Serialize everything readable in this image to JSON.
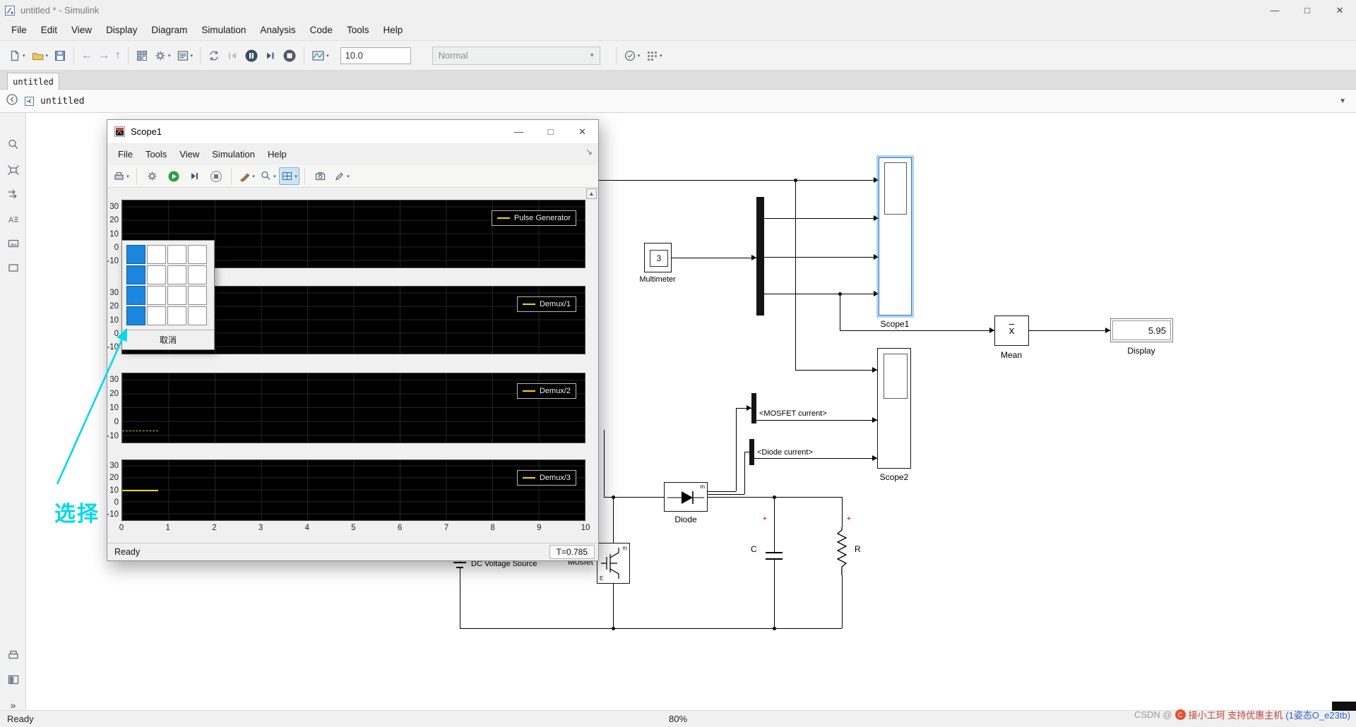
{
  "main_window": {
    "title": "untitled * - Simulink",
    "window_controls": {
      "minimize": "—",
      "maximize": "□",
      "close": "✕"
    },
    "menu": [
      "File",
      "Edit",
      "View",
      "Display",
      "Diagram",
      "Simulation",
      "Analysis",
      "Code",
      "Tools",
      "Help"
    ],
    "toolbar": {
      "stop_time": "10.0",
      "mode": "Normal"
    },
    "tab_label": "untitled",
    "breadcrumb": "untitled",
    "statusbar": {
      "ready": "Ready",
      "zoom": "80%"
    }
  },
  "icons": {
    "caret": "▾",
    "breadcrumb_drop": "▼",
    "dock": "↘",
    "scroll_up": "▲",
    "chevrons": "»",
    "back": "←",
    "forward": "→",
    "up": "↑"
  },
  "scope": {
    "title": "Scope1",
    "window_controls": {
      "minimize": "—",
      "maximize": "□",
      "close": "✕"
    },
    "menu": [
      "File",
      "Tools",
      "View",
      "Simulation",
      "Help"
    ],
    "y_ticks": [
      "30",
      "20",
      "10",
      "0",
      "-10"
    ],
    "x_ticks": [
      "0",
      "1",
      "2",
      "3",
      "4",
      "5",
      "6",
      "7",
      "8",
      "9",
      "10"
    ],
    "plots": [
      {
        "legend": "Pulse Generator"
      },
      {
        "legend": "Demux/1"
      },
      {
        "legend": "Demux/2"
      },
      {
        "legend": "Demux/3"
      }
    ],
    "layout_picker": {
      "cells": [
        "sel",
        "",
        "",
        "",
        "sel",
        "",
        "",
        "",
        "sel",
        "",
        "",
        "",
        "sel",
        "",
        "",
        ""
      ],
      "cancel": "取消"
    },
    "status": {
      "ready": "Ready",
      "time": "T=0.785"
    }
  },
  "chart_data": {
    "type": "line",
    "xlim": [
      0,
      10
    ],
    "ylim": [
      -10,
      30
    ],
    "x_ticks": [
      0,
      1,
      2,
      3,
      4,
      5,
      6,
      7,
      8,
      9,
      10
    ],
    "y_ticks": [
      30,
      20,
      10,
      0,
      -10
    ],
    "sim_time_end": 0.785,
    "grid": true,
    "legend_position": "top-right",
    "subplots": [
      {
        "legend": "Pulse Generator",
        "trace": null
      },
      {
        "legend": "Demux/1",
        "trace": null
      },
      {
        "legend": "Demux/2",
        "trace": {
          "x": [
            0,
            0.785
          ],
          "y": [
            -7,
            -7
          ],
          "style": "dashed"
        }
      },
      {
        "legend": "Demux/3",
        "trace": {
          "x": [
            0,
            0.785
          ],
          "y": [
            10,
            10
          ],
          "style": "solid"
        }
      }
    ]
  },
  "diagram": {
    "multimeter": {
      "value": "3",
      "label": "Multimeter"
    },
    "scope1_label": "Scope1",
    "scope2_label": "Scope2",
    "mean": {
      "glyph": "x",
      "label": "Mean"
    },
    "display": {
      "value": "5.95",
      "label": "Display"
    },
    "diode": {
      "label": "Diode",
      "port_m": "m"
    },
    "mosfet": {
      "label": "Mosfet",
      "port_m": "m",
      "port_e": "E"
    },
    "dc_source_label": "DC Voltage Source",
    "cap_label": "C",
    "res_label": "R",
    "mosfet_current_label": "<MOSFET current>",
    "diode_current_label": "<Diode current>",
    "polarity_mark": "+"
  },
  "annotation": {
    "text": "选择"
  },
  "watermark": {
    "prefix": "CSDN @",
    "user": "接小工珂 支持优惠主机",
    "suffix": "(1姿态O_e23tb)"
  }
}
